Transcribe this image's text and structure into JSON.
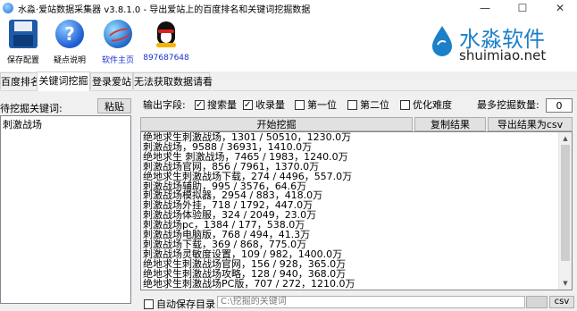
{
  "window": {
    "title": "水淼·爱站数据采集器 v3.8.1.0 - 导出爱站上的百度排名和关键词挖掘数据",
    "minimize": "—",
    "maximize": "☐",
    "close": "✕"
  },
  "toolbar": {
    "save_label": "保存配置",
    "help_label": "疑点说明",
    "home_label": "软件主页",
    "qq_label": "897687648"
  },
  "brand": {
    "name_cn": "水淼软件",
    "url": "shuimiao.net",
    "color": "#1b7fc9"
  },
  "tabs": [
    "百度排名",
    "关键词挖掘",
    "登录爱站",
    "无法获取数据请看"
  ],
  "left": {
    "label": "待挖掘关键词:",
    "paste_label": "粘贴",
    "keyword": "刺激战场"
  },
  "options": {
    "fields_label": "输出字段:",
    "search_volume": "搜索量",
    "collect_volume": "收录量",
    "first": "第一位",
    "second": "第二位",
    "difficulty": "优化难度",
    "max_label": "最多挖掘数量:",
    "max_value": "0"
  },
  "actions": {
    "start": "开始挖掘",
    "copy": "复制结果",
    "export": "导出结果为csv"
  },
  "results": [
    "绝地求生刺激战场，1301 / 50510，1230.0万",
    "刺激战场，9588 / 36931，1410.0万",
    "绝地求生 刺激战场，7465 / 1983，1240.0万",
    "刺激战场官网，856 / 7961，1370.0万",
    "绝地求生刺激战场下载，274 / 4496，557.0万",
    "刺激战场辅助，995 / 3576，64.6万",
    "刺激战场模拟器，2954 / 883，418.0万",
    "刺激战场外挂，718 / 1792，447.0万",
    "刺激战场体验服，324 / 2049，23.0万",
    "刺激战场pc，1384 / 177，538.0万",
    "刺激战场电脑版，768 / 494，41.3万",
    "刺激战场下载，369 / 868，775.0万",
    "刺激战场灵敏度设置，109 / 982，1400.0万",
    "绝地求生刺激战场官网，156 / 928，365.0万",
    "绝地求生刺激战场攻略，128 / 940，368.0万",
    "绝地求生刺激战场PC版，707 / 272，1210.0万"
  ],
  "bottom": {
    "autosave": "自动保存目录",
    "path_placeholder": "C:\\挖掘的关键词",
    "csv": "csv"
  }
}
